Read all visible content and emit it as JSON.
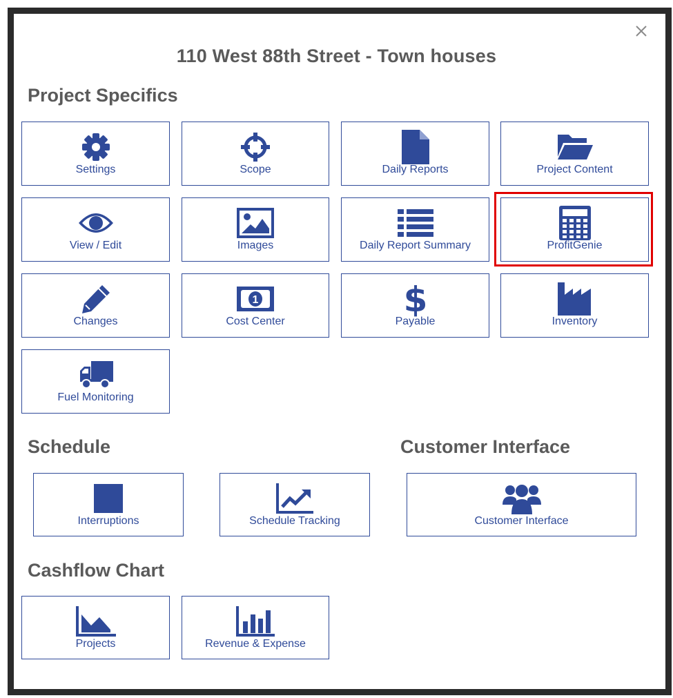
{
  "dialog": {
    "title": "110 West 88th Street - Town houses",
    "close_icon": "close-icon"
  },
  "sections": {
    "project_specifics": "Project Specifics",
    "schedule": "Schedule",
    "customer_interface": "Customer Interface",
    "cashflow_chart": "Cashflow Chart"
  },
  "tiles": {
    "settings": {
      "label": "Settings",
      "icon": "gear-icon"
    },
    "scope": {
      "label": "Scope",
      "icon": "crosshairs-icon"
    },
    "daily_reports": {
      "label": "Daily Reports",
      "icon": "document-icon"
    },
    "project_content": {
      "label": "Project Content",
      "icon": "folder-open-icon"
    },
    "view_edit": {
      "label": "View / Edit",
      "icon": "eye-icon"
    },
    "images": {
      "label": "Images",
      "icon": "image-icon"
    },
    "daily_report_summary": {
      "label": "Daily Report Summary",
      "icon": "list-icon"
    },
    "profitgenie": {
      "label": "ProfitGenie",
      "icon": "calculator-icon"
    },
    "changes": {
      "label": "Changes",
      "icon": "pencil-icon"
    },
    "cost_center": {
      "label": "Cost Center",
      "icon": "money-icon"
    },
    "payable": {
      "label": "Payable",
      "icon": "dollar-icon"
    },
    "inventory": {
      "label": "Inventory",
      "icon": "industry-icon"
    },
    "fuel_monitoring": {
      "label": "Fuel Monitoring",
      "icon": "truck-icon"
    },
    "interruptions": {
      "label": "Interruptions",
      "icon": "square-icon"
    },
    "schedule_tracking": {
      "label": "Schedule Tracking",
      "icon": "line-chart-icon"
    },
    "customer_interface": {
      "label": "Customer Interface",
      "icon": "users-icon"
    },
    "projects": {
      "label": "Projects",
      "icon": "area-chart-icon"
    },
    "revenue_expense": {
      "label": "Revenue & Expense",
      "icon": "bar-chart-icon"
    }
  },
  "colors": {
    "accent": "#2f4a99",
    "heading": "#5a5a5a",
    "highlight": "#e00000"
  }
}
